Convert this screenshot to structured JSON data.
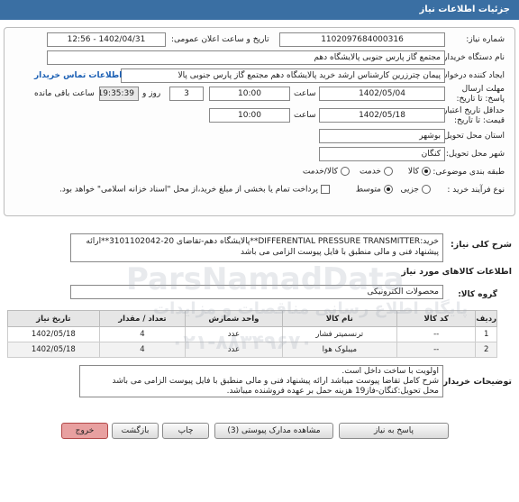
{
  "header": {
    "title": "جزئیات اطلاعات نیاز"
  },
  "form": {
    "need_number_label": "شماره نیاز:",
    "need_number": "1102097684000316",
    "announce_datetime_label": "تاریخ و ساعت اعلان عمومی:",
    "announce_datetime": "1402/04/31 - 12:56",
    "buyer_name_label": "نام دستگاه خریدار:",
    "buyer_name": "مجتمع گاز پارس جنوبی  پالایشگاه دهم",
    "requester_label": "ایجاد کننده درخواست:",
    "requester": "پیمان چترزرین کارشناس ارشد خرید پالایشگاه دهم مجتمع گاز پارس جنوبی  پالا",
    "contact_link": "اطلاعات تماس خریدار",
    "deadline_label": "مهلت ارسال پاسخ: تا تاریخ:",
    "deadline_date": "1402/05/04",
    "time_label": "ساعت",
    "deadline_time": "10:00",
    "days_value": "3",
    "days_label": "روز و",
    "remaining_time": "19:35:39",
    "remaining_label": "ساعت باقی مانده",
    "validity_label": "حداقل تاریخ اعتبار قیمت: تا تاریخ:",
    "validity_date": "1402/05/18",
    "validity_time": "10:00",
    "province_label": "استان محل تحویل:",
    "province": "بوشهر",
    "city_label": "شهر محل تحویل:",
    "city": "کنگان",
    "category_label": "طبقه بندی موضوعی:",
    "category_options": [
      "کالا",
      "خدمت",
      "کالا/خدمت"
    ],
    "purchase_type_label": "نوع فرآیند خرید :",
    "purchase_type_options": [
      "جزیی",
      "متوسط"
    ],
    "payment_note": "پرداخت تمام یا بخشی از مبلغ خرید،از محل \"اسناد خزانه اسلامی\" خواهد بود."
  },
  "summary": {
    "label": "شرح کلی نیاز:",
    "text": "خرید:DIFFERENTIAL PRESSURE TRANSMITTER**پالایشگاه دهم-تقاضای 20-3101102042**ارائه پیشنهاد فنی و مالی منطبق با فایل پیوست الزامی می باشد"
  },
  "goods_section": {
    "title": "اطلاعات کالاهای مورد نیاز",
    "group_label": "گروه کالا:",
    "group_value": "محصولات الکترونیکی"
  },
  "table": {
    "headers": [
      "ردیف",
      "کد کالا",
      "نام کالا",
      "واحد شمارش",
      "تعداد / مقدار",
      "تاریخ نیاز"
    ],
    "rows": [
      [
        "1",
        "--",
        "ترنسمیتر فشار",
        "عدد",
        "4",
        "1402/05/18"
      ],
      [
        "2",
        "--",
        "میبلوک هوا",
        "عدد",
        "4",
        "1402/05/18"
      ]
    ]
  },
  "buyer_notes": {
    "label": "توضیحات خریدار:",
    "lines": [
      "اولویت با ساخت داخل است.",
      "شرح کامل تقاضا پیوست میباشد ارائه پیشنهاد فنی و مالی منطبق با فایل پیوست الزامی می باشد",
      "محل تحویل:کنگان-فاز19 هزینه حمل بر عهده فروشنده میباشد."
    ]
  },
  "buttons": {
    "reply": "پاسخ به نیاز",
    "docs": "مشاهده مدارک پیوستی (3)",
    "print": "چاپ",
    "back": "بازگشت",
    "exit": "خروج"
  },
  "watermark": {
    "brand": "ParsNamadData",
    "subtitle": "پایگاه اطلاع رسانی مناقصات و مزایدات",
    "phone": "۰۲۱-۸۸۳۴۹۶۷۰"
  }
}
